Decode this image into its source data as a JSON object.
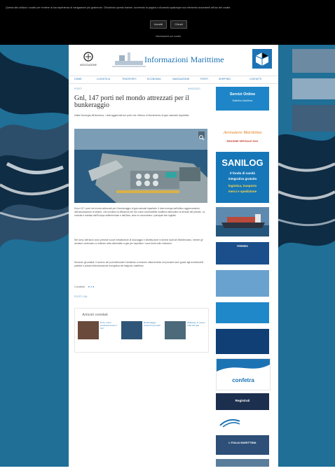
{
  "cookie": {
    "text": "Questo sito utilizza i cookie per rendere la tua esperienza di navigazione più gradevole. Chiudendo questo banner, scorrendo la pagina o cliccando qualunque suo elemento acconsenti all'uso dei cookie.",
    "accept_label": "Accetti",
    "close_label": "Chiudi",
    "more_label": "Informazioni sui cookie"
  },
  "header": {
    "logo_text": "ASSOCIAZIONE",
    "title": "Informazioni Marittime"
  },
  "nav": {
    "items": [
      "HOME",
      "LOGISTICA",
      "TRASPORTI",
      "ECONOMIA",
      "NAVIGAZIONE",
      "PORTI",
      "SHIPPING",
      "CONTATTI"
    ]
  },
  "article": {
    "breadcrumb": "PORTI",
    "date": "09/02/2021",
    "title": "Gnl, 147 porti nel mondo attrezzati per il bunkeraggio",
    "subtitle": "Dalla Norvegia all'America, i dati aggiornati sui porti che offrono il rifornimento di gas naturale liquefatto",
    "paragraphs": [
      "Sono 147 i porti nel mondo attrezzati per il bunkeraggio di gas naturale liquefatto. Il dato emerge dall'ultimo aggiornamento dell'associazione di settore, che monitora la diffusione del Gnl come combustibile marittimo alternativo ai derivati del petrolio. La crescita è trainata dall'Europa settentrionale e dall'Asia, dove si concentrano i principali hub logistici.",
      "Nel corso dell'anno sono previste nuove infrastrutture di stoccaggio e distribuzione in diversi scali del Mediterraneo, mentre gli armatori continuano a ordinare unità alimentate a gas per rispettare i nuovi limiti sulle emissioni.",
      "Secondo gli analisti, il numero dei porti attrezzati è destinato a crescere ulteriormente nei prossimi anni grazie agli investimenti pubblici e privati nella transizione energetica del trasporto marittimo."
    ],
    "share_label": "Condividi",
    "tag": "PORTI GNL"
  },
  "related": {
    "title": "Articoli correlati",
    "items": [
      {
        "title": "Porti, nuovi investimenti per il Gnl"
      },
      {
        "title": "Bunkeraggio, crescono gli scali"
      },
      {
        "title": "Shipping, le nuove rotte del gas"
      }
    ]
  },
  "sidebar": {
    "services_title": "Servizi Online",
    "services_sub": "Bollettino Marittimo",
    "bollettino_title": "Avvisatore Marittimo",
    "bollettino_sub": "EDIZIONE SPECIALE 2021",
    "sanilog_title": "SANILOG",
    "sanilog_line1": "Il fondo di sanità",
    "sanilog_line2": "integrativa gratuito",
    "sanilog_line3": "logistica, trasporto",
    "sanilog_line4": "merci e spedizione",
    "ad_fastline": "FERRIES",
    "confetra": "confetra",
    "button_label": "Registrati",
    "italia_label": "L'ITALIA MARITTIMA"
  },
  "colors": {
    "brand_blue": "#1c73b4",
    "background_sea": "#1f6f97",
    "sanilog_blue": "#1677b8",
    "bollettino_orange": "#e07a14"
  }
}
